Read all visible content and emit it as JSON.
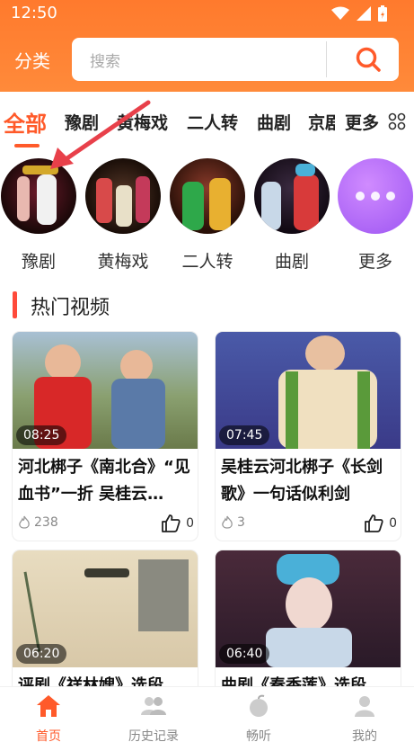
{
  "status": {
    "time": "12:50"
  },
  "header": {
    "category_label": "分类",
    "search_placeholder": "搜索"
  },
  "tabs": [
    {
      "label": "全部",
      "active": true
    },
    {
      "label": "豫剧"
    },
    {
      "label": "黄梅戏"
    },
    {
      "label": "二人转"
    },
    {
      "label": "曲剧"
    },
    {
      "label": "京剧"
    },
    {
      "label": "更多"
    }
  ],
  "categories": [
    {
      "label": "豫剧"
    },
    {
      "label": "黄梅戏"
    },
    {
      "label": "二人转"
    },
    {
      "label": "曲剧"
    },
    {
      "label": "更多"
    }
  ],
  "section": {
    "title": "热门视频"
  },
  "videos": [
    {
      "duration": "08:25",
      "title": "河北梆子《南北合》“见血书”一折 吴桂云…",
      "views": "238",
      "likes": "0"
    },
    {
      "duration": "07:45",
      "title": "吴桂云河北梆子《长剑歌》一句话似利剑",
      "views": "3",
      "likes": "0"
    },
    {
      "duration": "06:20",
      "title": "评剧《祥林嫂》选段",
      "views": "",
      "likes": ""
    },
    {
      "duration": "06:40",
      "title": "曲剧《秦香莲》选段",
      "views": "",
      "likes": ""
    }
  ],
  "bottom_nav": [
    {
      "label": "首页",
      "icon": "home-icon",
      "active": true
    },
    {
      "label": "历史记录",
      "icon": "history-icon"
    },
    {
      "label": "畅听",
      "icon": "listen-icon"
    },
    {
      "label": "我的",
      "icon": "profile-icon"
    }
  ],
  "colors": {
    "accent": "#ff5a2a",
    "header": "#ff7a2d",
    "more_purple": "#a75df5"
  }
}
